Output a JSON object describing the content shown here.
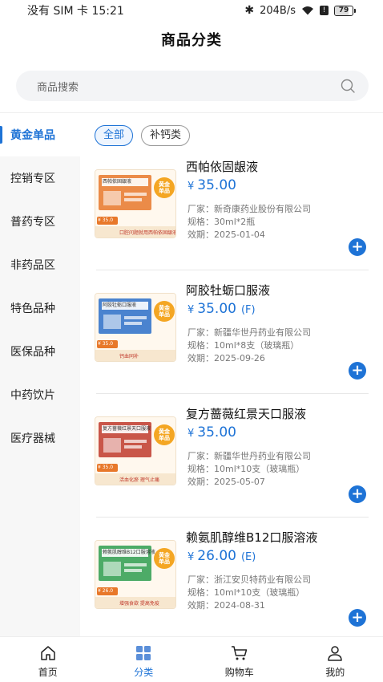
{
  "status_bar": {
    "carrier_time": "没有 SIM 卡 15:21",
    "net_speed": "204B/s",
    "battery": "79",
    "battery_level": 0.79
  },
  "header": {
    "title": "商品分类"
  },
  "search": {
    "placeholder": "商品搜索"
  },
  "sidebar": {
    "items": [
      {
        "label": "黄金单品",
        "active": true
      },
      {
        "label": "控销专区"
      },
      {
        "label": "普药专区"
      },
      {
        "label": "非药品区"
      },
      {
        "label": "特色品种"
      },
      {
        "label": "医保品种"
      },
      {
        "label": "中药饮片"
      },
      {
        "label": "医疗器械"
      }
    ]
  },
  "filters": [
    {
      "label": "全部",
      "active": true
    },
    {
      "label": "补钙类"
    }
  ],
  "products": [
    {
      "name": "西帕依固龈液",
      "currency": "¥",
      "price": "35.00",
      "tag": "",
      "maker": "厂家：新奇康药业股份有限公司",
      "spec": "规格：30ml*2瓶",
      "expiry": "效期：2025-01-04",
      "thumb": {
        "box_title": "西帕依固龈液",
        "badge": "黄金单品",
        "strip": "口腔问题就用西帕依固龈液",
        "price_small": "¥ 35.0",
        "accent": "#e8782a"
      }
    },
    {
      "name": "阿胶牡蛎口服液",
      "currency": "¥",
      "price": "35.00",
      "tag": "(F)",
      "maker": "厂家：新疆华世丹药业有限公司",
      "spec": "规格：10ml*8支（玻璃瓶）",
      "expiry": "效期：2025-09-26",
      "thumb": {
        "box_title": "阿胶牡蛎口服液",
        "badge": "黄金单品",
        "strip": "钙血同补",
        "price_small": "¥ 35.0",
        "accent": "#2a6fc9"
      }
    },
    {
      "name": "复方蔷薇红景天口服液",
      "currency": "¥",
      "price": "35.00",
      "tag": "",
      "maker": "厂家：新疆华世丹药业有限公司",
      "spec": "规格：10ml*10支（玻璃瓶）",
      "expiry": "效期：2025-05-07",
      "thumb": {
        "box_title": "复方蔷薇红景天口服液",
        "badge": "黄金单品",
        "strip": "活血化瘀 理气止痛",
        "price_small": "¥ 35.0",
        "accent": "#c0392b"
      }
    },
    {
      "name": "赖氨肌醇维B12口服溶液",
      "currency": "¥",
      "price": "26.00",
      "tag": "(E)",
      "maker": "厂家：浙江安贝特药业有限公司",
      "spec": "规格：10ml*10支（玻璃瓶）",
      "expiry": "效期：2024-08-31",
      "thumb": {
        "box_title": "赖氨肌醇维B12口服溶液",
        "badge": "黄金单品",
        "strip": "增强食欲 提高免疫",
        "price_small": "¥ 26.0",
        "accent": "#2e9e4f"
      }
    }
  ],
  "bottom_nav": [
    {
      "label": "首页",
      "icon": "home-icon"
    },
    {
      "label": "分类",
      "icon": "category-icon",
      "active": true
    },
    {
      "label": "购物车",
      "icon": "cart-icon"
    },
    {
      "label": "我的",
      "icon": "profile-icon"
    }
  ],
  "colors": {
    "accent": "#1e73d6",
    "sidebar_bg": "#f7f7f7"
  }
}
